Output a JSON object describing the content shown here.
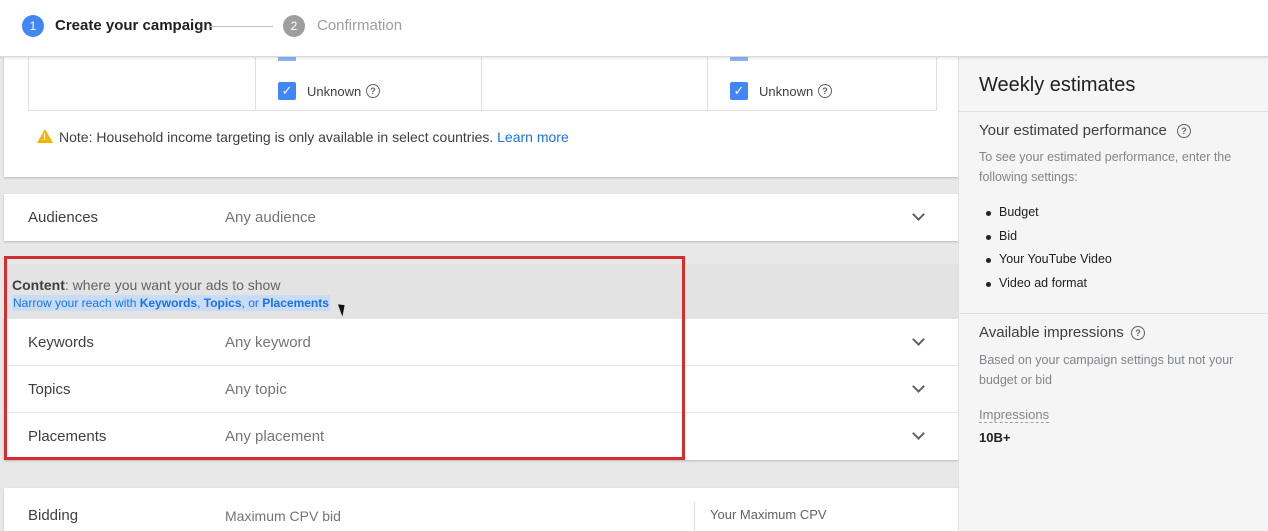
{
  "stepper": {
    "step1_number": "1",
    "step1_label": "Create your campaign",
    "step2_number": "2",
    "step2_label": "Confirmation"
  },
  "income": {
    "unknown_label_1": "Unknown",
    "unknown_label_2": "Unknown",
    "checkmark": "✓",
    "help_glyph": "?",
    "note_text": "Note: Household income targeting is only available in select countries.",
    "learn_more": "Learn more"
  },
  "audiences": {
    "label": "Audiences",
    "value": "Any audience"
  },
  "content": {
    "title_bold": "Content",
    "title_rest": ": where you want your ads to show",
    "sub_prefix": "Narrow your reach with ",
    "sub_keywords": "Keywords",
    "sub_comma": ", ",
    "sub_topics": "Topics",
    "sub_or": ", or ",
    "sub_placements": "Placements",
    "rows": [
      {
        "label": "Keywords",
        "value": "Any keyword"
      },
      {
        "label": "Topics",
        "value": "Any topic"
      },
      {
        "label": "Placements",
        "value": "Any placement"
      }
    ]
  },
  "bidding": {
    "label": "Bidding",
    "value": "Maximum CPV bid",
    "right_label": "Your Maximum CPV"
  },
  "panel": {
    "title": "Weekly estimates",
    "perf_heading": "Your estimated performance",
    "perf_text": "To see your estimated performance, enter the following settings:",
    "settings": [
      "Budget",
      "Bid",
      "Your YouTube Video",
      "Video ad format"
    ],
    "avail_heading": "Available impressions",
    "avail_text": "Based on your campaign settings but not your budget or bid",
    "impressions_label": "Impressions",
    "impressions_value": "10B+"
  },
  "colors": {
    "accent": "#4285f4",
    "link": "#1a73e8",
    "highlight_box": "#d32f2f",
    "warning": "#f4b400"
  },
  "icons": [
    "step-indicator",
    "checkbox-checked-icon",
    "help-icon",
    "warning-icon",
    "chevron-down-icon",
    "mouse-cursor-icon"
  ]
}
